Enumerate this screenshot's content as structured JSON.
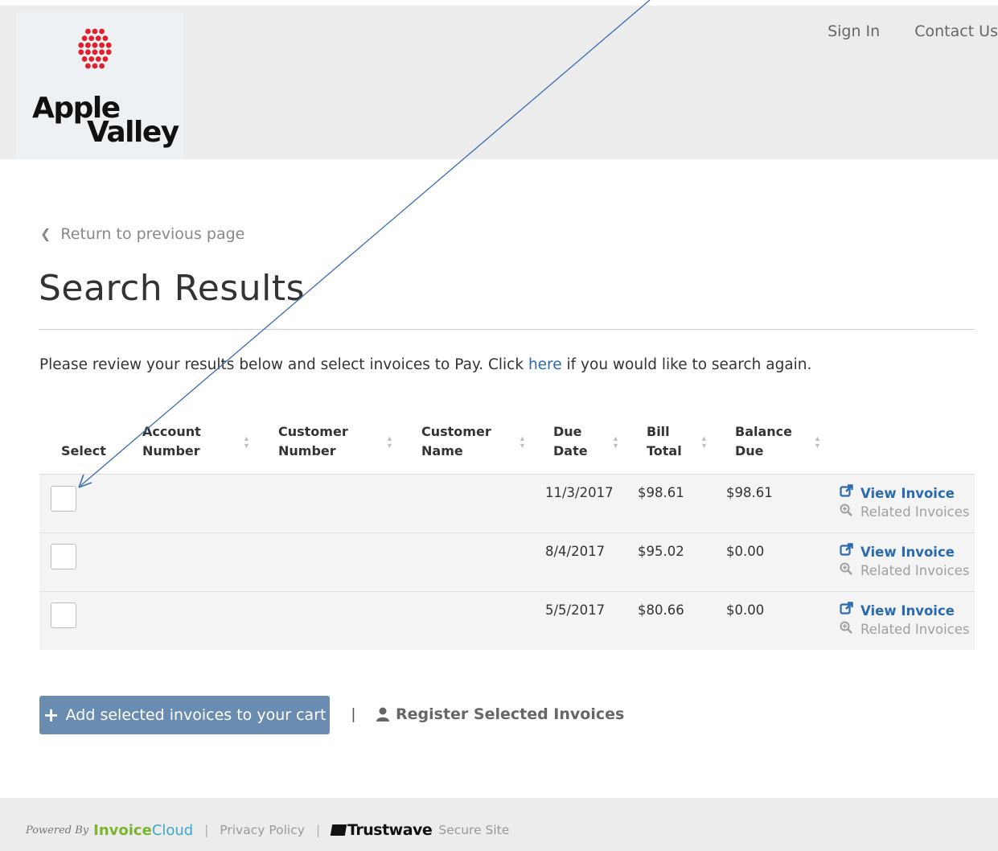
{
  "header": {
    "logo": {
      "line1": "Apple",
      "line2": "Valley"
    },
    "nav": {
      "sign_in": "Sign In",
      "contact_us": "Contact Us"
    }
  },
  "main": {
    "back_link": "Return to previous page",
    "title": "Search Results",
    "instructions": {
      "before": "Please review your results below and select invoices to Pay. Click ",
      "link": "here",
      "after": " if you would like to search again."
    },
    "table": {
      "headers": {
        "select": "Select",
        "account_number": [
          "Account",
          "Number"
        ],
        "customer_number": [
          "Customer",
          "Number"
        ],
        "customer_name": [
          "Customer",
          "Name"
        ],
        "due_date": [
          "Due",
          "Date"
        ],
        "bill_total": [
          "Bill",
          "Total"
        ],
        "balance_due": [
          "Balance",
          "Due"
        ]
      },
      "rows": [
        {
          "due_date": "11/3/2017",
          "bill_total": "$98.61",
          "balance_due": "$98.61",
          "view": "View Invoice",
          "related": "Related Invoices"
        },
        {
          "due_date": "8/4/2017",
          "bill_total": "$95.02",
          "balance_due": "$0.00",
          "view": "View Invoice",
          "related": "Related Invoices"
        },
        {
          "due_date": "5/5/2017",
          "bill_total": "$80.66",
          "balance_due": "$0.00",
          "view": "View Invoice",
          "related": "Related Invoices"
        }
      ]
    },
    "add_button": "Add selected invoices to your cart",
    "separator": "|",
    "register_link": "Register Selected Invoices"
  },
  "footer": {
    "powered_by": "Powered By",
    "brand_bold": "Invoice",
    "brand_light": "Cloud",
    "separator": "|",
    "privacy_policy": "Privacy Policy",
    "trustwave": "Trustwave",
    "secure_site": "Secure Site"
  },
  "colors": {
    "link_blue": "#2a6ab0",
    "button_blue": "#6b8cb1",
    "header_gray": "#ececec",
    "row_gray": "#f4f4f4",
    "logo_red": "#e2202c",
    "annotation_arrow": "#3c6cb4"
  },
  "icons": {
    "back": "chevron-left-icon",
    "view_invoice": "external-link-icon",
    "related_invoices": "magnifier-icon",
    "add": "plus-icon",
    "register": "user-icon",
    "sort": "sort-icon"
  }
}
